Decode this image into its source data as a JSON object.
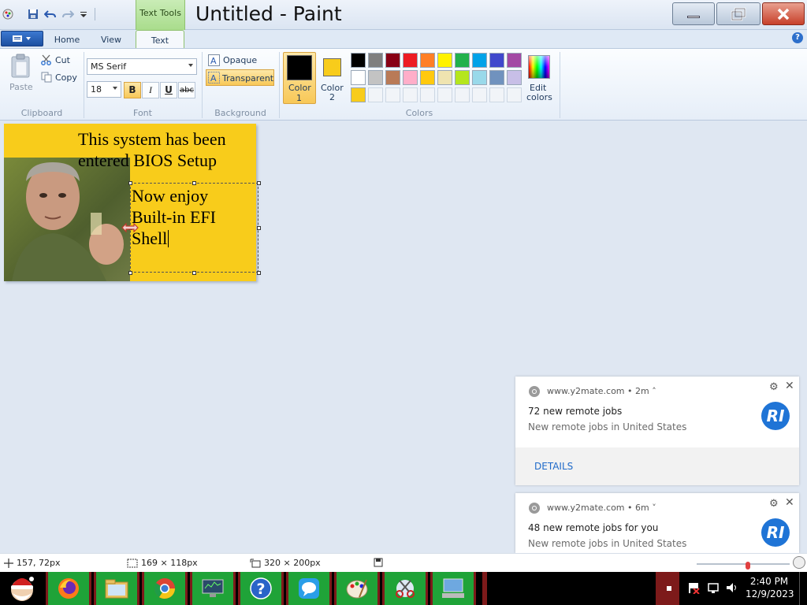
{
  "window": {
    "title": "Untitled - Paint",
    "context_tab": "Text Tools"
  },
  "tabs": [
    {
      "label": "Home"
    },
    {
      "label": "View"
    },
    {
      "label": "Text"
    }
  ],
  "ribbon": {
    "clipboard": {
      "label": "Clipboard",
      "paste": "Paste",
      "cut": "Cut",
      "copy": "Copy"
    },
    "font": {
      "label": "Font",
      "family": "MS Serif",
      "size": "18",
      "bold": "B",
      "italic": "I",
      "underline": "U",
      "strikethrough": "abc"
    },
    "background": {
      "label": "Background",
      "opaque": "Opaque",
      "transparent": "Transparent"
    },
    "colors": {
      "label": "Colors",
      "color1_label": "Color",
      "color1_num": "1",
      "color2_label": "Color",
      "color2_num": "2",
      "color1_value": "#000000",
      "color2_value": "#f8cc1b",
      "edit_colors_line1": "Edit",
      "edit_colors_line2": "colors",
      "palette_row1": [
        "#000000",
        "#7f7f7f",
        "#880015",
        "#ed1c24",
        "#ff7f27",
        "#fff200",
        "#22b14c",
        "#00a2e8",
        "#3f48cc",
        "#a349a4"
      ],
      "palette_row2": [
        "#ffffff",
        "#c3c3c3",
        "#b97a57",
        "#ffaec9",
        "#ffc90e",
        "#efe4b0",
        "#b5e61d",
        "#99d9ea",
        "#7092be",
        "#c8bfe7"
      ],
      "palette_row3": [
        "#f8cc1b"
      ]
    }
  },
  "canvas": {
    "text_line1": "This system has been",
    "text_line2": "entered BIOS Setup",
    "edit_line1": "Now enjoy",
    "edit_line2": "Built-in EFI",
    "edit_line3": "Shell"
  },
  "notifications": [
    {
      "source": "www.y2mate.com",
      "age": "2m",
      "title": "72 new remote jobs",
      "subtitle": "New remote jobs in United States",
      "logo": "RI",
      "action": "DETAILS"
    },
    {
      "source": "www.y2mate.com",
      "age": "6m",
      "title": "48 new remote jobs for you",
      "subtitle": "New remote jobs in United States",
      "logo": "RI"
    }
  ],
  "status": {
    "cursor_pos": "157, 72px",
    "selection_size": "169 × 118px",
    "image_size": "320 × 200px"
  },
  "clock": {
    "time": "2:40 PM",
    "date": "12/9/2023"
  }
}
